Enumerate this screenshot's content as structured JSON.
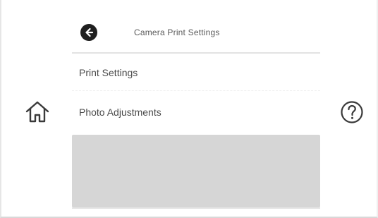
{
  "header": {
    "title": "Camera Print Settings",
    "back_icon": "arrow-left-circle-icon"
  },
  "menu": {
    "items": [
      {
        "label": "Print Settings"
      },
      {
        "label": "Photo Adjustments"
      }
    ]
  },
  "sidebar": {
    "home_icon": "home-icon",
    "help_icon": "help-circle-icon"
  },
  "colors": {
    "background": "#ffffff",
    "disabled_block": "#d6d6d6",
    "text": "#4a4a4a",
    "back_button": "#1f1f1f"
  }
}
